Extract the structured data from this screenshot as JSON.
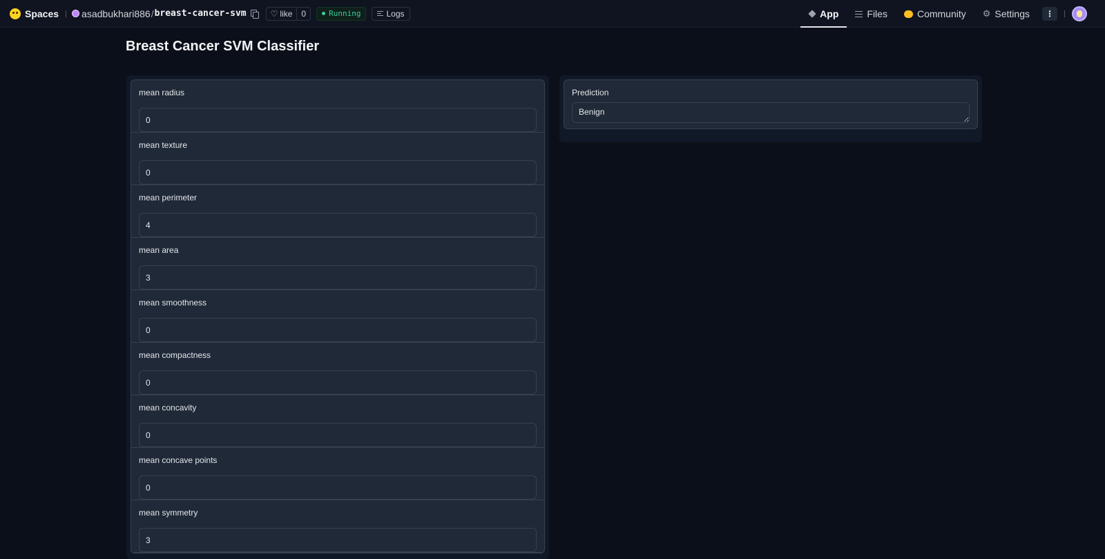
{
  "header": {
    "brand": "Spaces",
    "owner": "asadbukhari886",
    "separator": "/",
    "repo_name": "breast-cancer-svm",
    "like_label": "like",
    "like_count": "0",
    "status": "Running",
    "logs_label": "Logs",
    "nav": {
      "app": "App",
      "files": "Files",
      "community": "Community",
      "settings": "Settings"
    },
    "more_label": "⋮"
  },
  "page": {
    "title": "Breast Cancer SVM Classifier"
  },
  "inputs": [
    {
      "label": "mean radius",
      "value": "0"
    },
    {
      "label": "mean texture",
      "value": "0"
    },
    {
      "label": "mean perimeter",
      "value": "4"
    },
    {
      "label": "mean area",
      "value": "3"
    },
    {
      "label": "mean smoothness",
      "value": "0"
    },
    {
      "label": "mean compactness",
      "value": "0"
    },
    {
      "label": "mean concavity",
      "value": "0"
    },
    {
      "label": "mean concave points",
      "value": "0"
    },
    {
      "label": "mean symmetry",
      "value": "3"
    }
  ],
  "output": {
    "label": "Prediction",
    "value": "Benign"
  },
  "colors": {
    "background": "#0b0f19",
    "panel": "#111827",
    "box": "#1f2937",
    "border": "#374151",
    "status_green": "#34d399"
  }
}
